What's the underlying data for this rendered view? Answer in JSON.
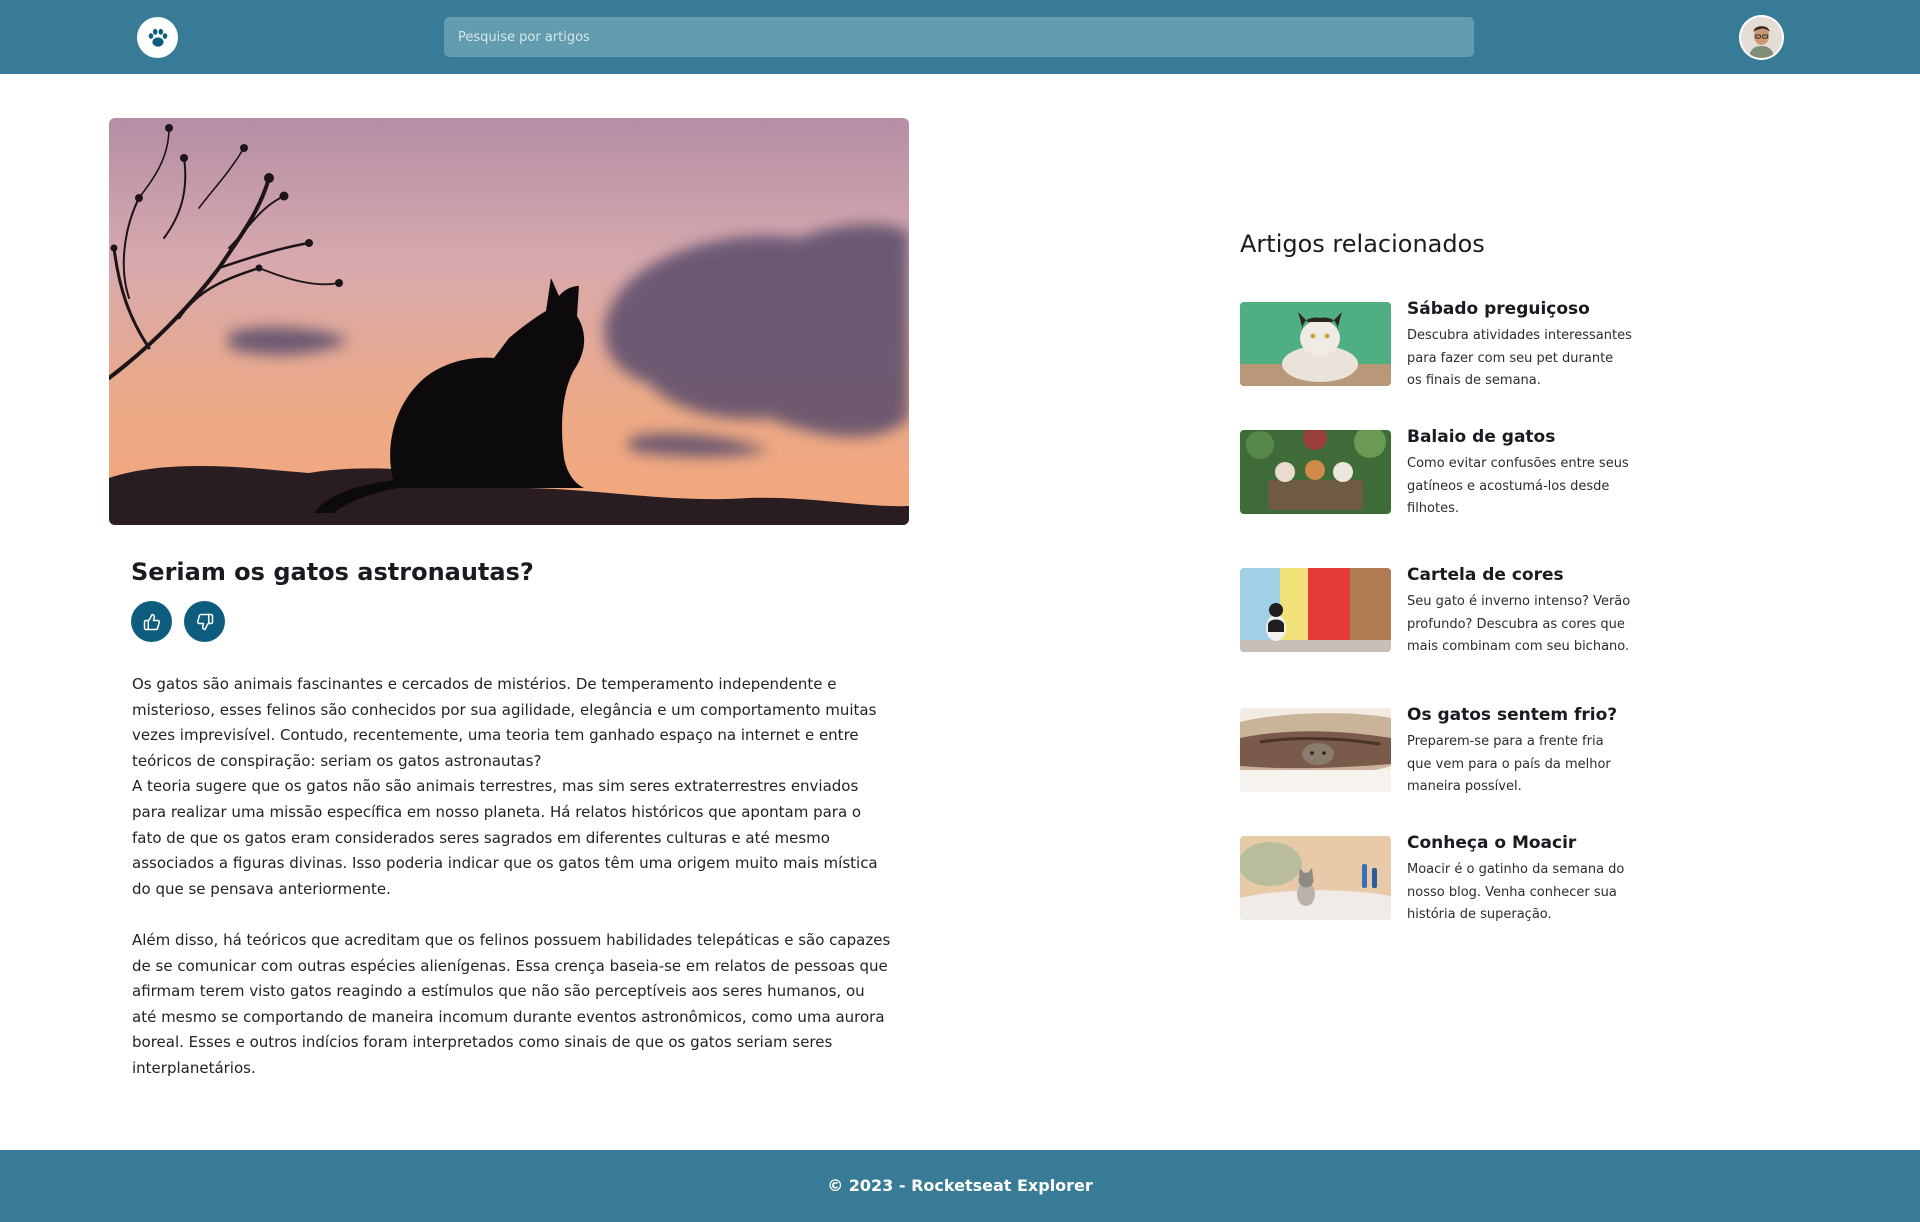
{
  "header": {
    "search_placeholder": "Pesquise por artigos",
    "logo_icon": "paw-icon",
    "avatar_icon": "user-avatar"
  },
  "article": {
    "hero_image": "cat-silhouette-sunset",
    "title": "Seriam os gatos astronautas?",
    "like_icon": "thumbs-up-icon",
    "dislike_icon": "thumbs-down-icon",
    "paragraphs": [
      "Os gatos são animais fascinantes e cercados de mistérios. De temperamento independente e misterioso, esses felinos são conhecidos por sua agilidade, elegância e um comportamento muitas vezes imprevisível. Contudo, recentemente, uma teoria tem ganhado espaço na internet e entre teóricos de conspiração: seriam os gatos astronautas?",
      "A teoria sugere que os gatos não são animais terrestres, mas sim seres extraterrestres enviados para realizar uma missão específica em nosso planeta. Há relatos históricos que apontam para o fato de que os gatos eram considerados seres sagrados em diferentes culturas e até mesmo associados a figuras divinas. Isso poderia indicar que os gatos têm uma origem muito mais mística do que se pensava anteriormente.",
      "Além disso, há teóricos que acreditam que os felinos possuem habilidades telepáticas e são capazes de se comunicar com outras espécies alienígenas. Essa crença baseia-se em relatos de pessoas que afirmam terem visto gatos reagindo a estímulos que não são perceptíveis aos seres humanos, ou até mesmo se comportando de maneira incomum durante eventos astronômicos, como uma aurora boreal. Esses e outros indícios foram interpretados como sinais de que os gatos seriam seres interplanetários."
    ]
  },
  "related": {
    "heading": "Artigos relacionados",
    "items": [
      {
        "title": "Sábado preguiçoso",
        "description": "Descubra atividades interessantes para fazer com seu pet durante os finais de semana.",
        "thumb": "cat-lying-green-wall"
      },
      {
        "title": "Balaio de gatos",
        "description": "Como evitar confusões entre seus gatíneos e acostumá-los desde filhotes.",
        "thumb": "kittens-in-basket"
      },
      {
        "title": "Cartela de cores",
        "description": "Seu gato é inverno intenso? Verão profundo? Descubra as cores que mais combinam com seu bichano.",
        "thumb": "cat-colorful-wall"
      },
      {
        "title": "Os gatos sentem frio?",
        "description": "Preparem-se para a frente fria que vem para o país da melhor maneira possível.",
        "thumb": "cat-under-blanket"
      },
      {
        "title": "Conheça o Moacir",
        "description": "Moacir é o gatinho da semana do nosso blog. Venha conhecer sua história de superação.",
        "thumb": "kitten-on-bed"
      }
    ]
  },
  "footer": {
    "text": "© 2023 - Rocketseat Explorer"
  },
  "colors": {
    "header_bg": "#377b96",
    "search_bg": "#629cae",
    "button_bg": "#0e5d7e"
  }
}
